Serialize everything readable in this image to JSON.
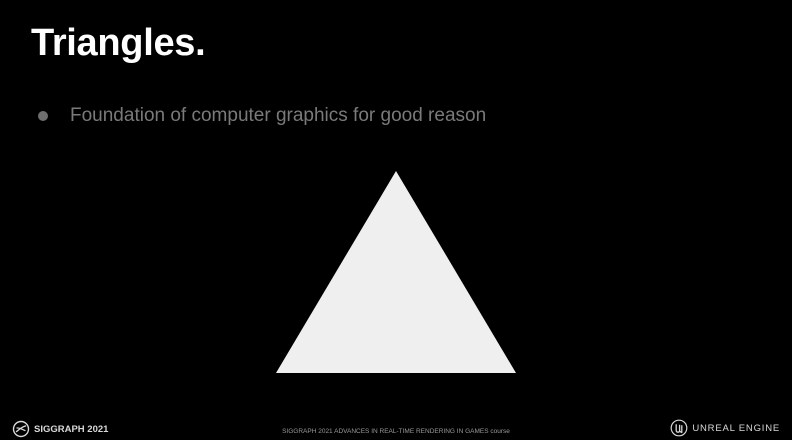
{
  "slide": {
    "title": "Triangles.",
    "bullets": [
      {
        "text": "Foundation of computer graphics for good reason"
      }
    ],
    "shape": {
      "type": "triangle",
      "fill": "#efefef"
    }
  },
  "footer": {
    "left_logo_icon": "siggraph-logo-icon",
    "left_label": "SIGGRAPH 2021",
    "center_label": "SIGGRAPH 2021 ADVANCES IN REAL-TIME RENDERING IN GAMES course",
    "right_logo_icon": "unreal-engine-logo-icon",
    "right_label": "UNREAL ENGINE"
  },
  "colors": {
    "background": "#000000",
    "title": "#ffffff",
    "bullet_text": "#7a7a7a",
    "bullet_dot": "#6e6e6e",
    "footer_text": "#d8d8d8"
  }
}
